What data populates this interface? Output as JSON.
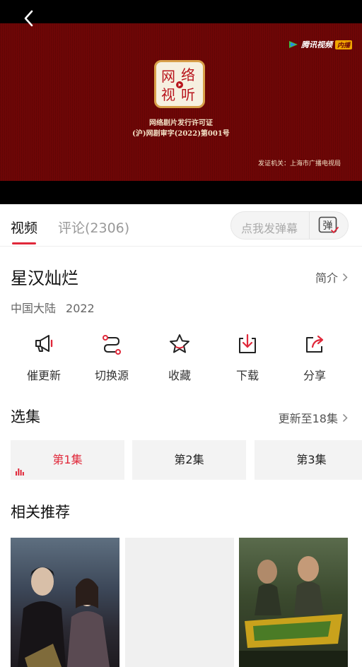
{
  "player": {
    "seal_text": "网络视听",
    "license_line1": "网络剧片发行许可证",
    "license_line2": "(沪)网剧审字(2022)第001号",
    "issuer": "发证机关：上海市广播电视局",
    "brand_name": "腾讯视频",
    "brand_badge": "内播"
  },
  "tabs": {
    "video": "视频",
    "comments": "评论(2306)"
  },
  "danmu": {
    "placeholder": "点我发弹幕",
    "toggle_label": "弹"
  },
  "info": {
    "title": "星汉灿烂",
    "intro_label": "简介",
    "region": "中国大陆",
    "year": "2022"
  },
  "actions": [
    {
      "label": "催更新",
      "icon": "megaphone-icon"
    },
    {
      "label": "切换源",
      "icon": "switch-source-icon"
    },
    {
      "label": "收藏",
      "icon": "star-icon"
    },
    {
      "label": "下载",
      "icon": "download-icon"
    },
    {
      "label": "分享",
      "icon": "share-icon"
    }
  ],
  "episodes": {
    "title": "选集",
    "update_info": "更新至18集",
    "items": [
      "第1集",
      "第2集",
      "第3集"
    ],
    "active_index": 0
  },
  "related": {
    "title": "相关推荐"
  },
  "colors": {
    "accent": "#e0283a",
    "player_bg": "#6e0606"
  }
}
